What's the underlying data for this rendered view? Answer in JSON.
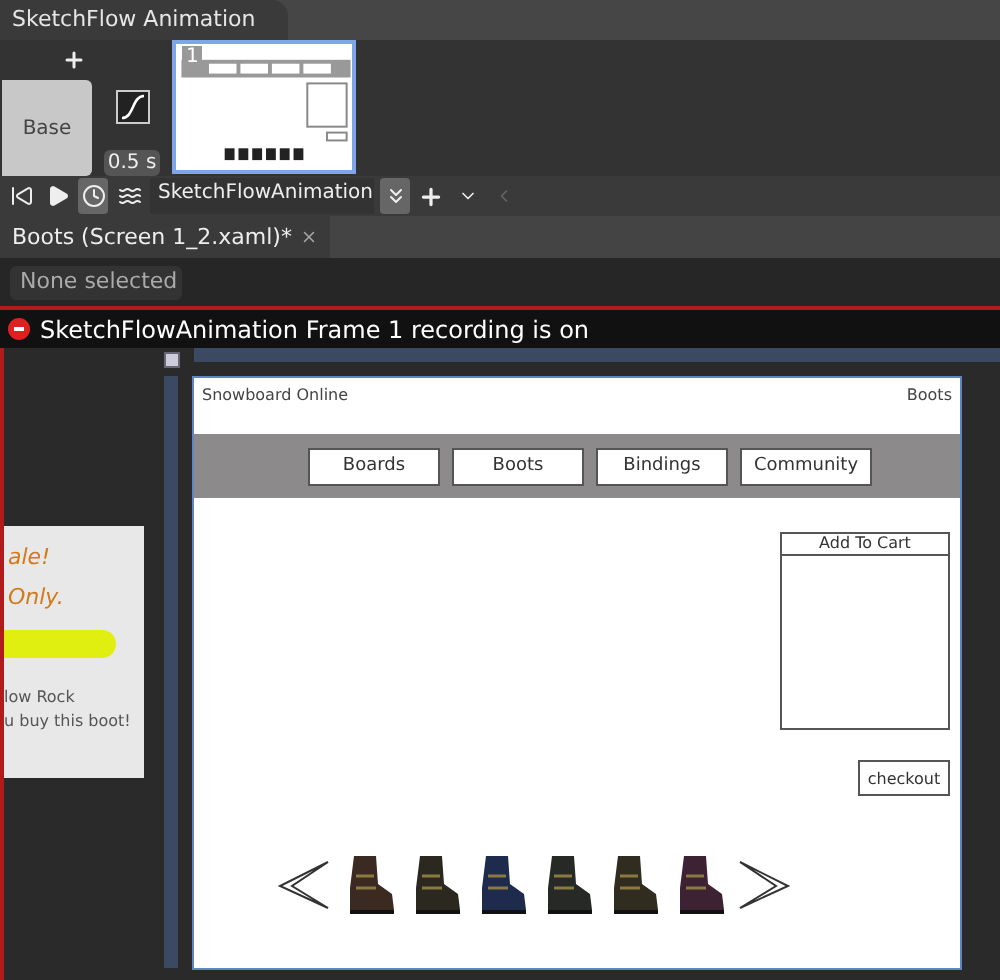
{
  "animation_tab": {
    "title": "SketchFlow Animation"
  },
  "states": {
    "base": "Base",
    "duration": "0.5 s",
    "frames": [
      {
        "number": "1",
        "selected": true
      }
    ]
  },
  "toolbar": {
    "animation_name": "SketchFlowAnimation",
    "time_view_selected": true
  },
  "document_tab": {
    "title": "Boots (Screen 1_2.xaml)*"
  },
  "selection": "None selected",
  "recording_banner": "SketchFlowAnimation Frame 1 recording is on",
  "sticky_note": {
    "heading_lines": [
      "ale!",
      "Only."
    ],
    "body_lines": [
      "low Rock",
      "u buy this boot!"
    ]
  },
  "mockup": {
    "site_title": "Snowboard Online",
    "page_title": "Boots",
    "nav": [
      "Boards",
      "Boots",
      "Bindings",
      "Community"
    ],
    "cart_title": "Add To Cart",
    "checkout": "checkout",
    "boots": [
      {
        "color": "#3b2a22"
      },
      {
        "color": "#2b2820"
      },
      {
        "color": "#1f2b4c"
      },
      {
        "color": "#262926"
      },
      {
        "color": "#302c20"
      },
      {
        "color": "#3c2232"
      }
    ]
  }
}
